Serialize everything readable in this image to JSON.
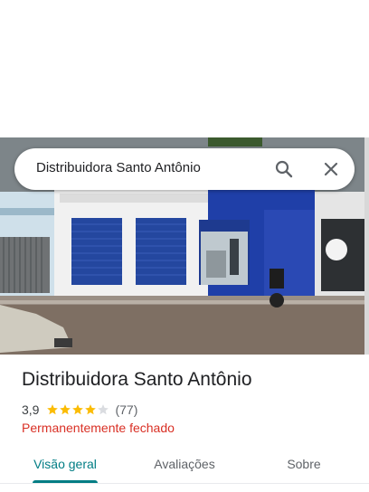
{
  "search": {
    "query": "Distribuidora Santo Antônio",
    "search_icon": "search-icon",
    "close_icon": "close-icon"
  },
  "hero": {
    "image": "storefront-photo"
  },
  "place": {
    "name": "Distribuidora Santo Antônio",
    "rating": "3,9",
    "stars": 3.9,
    "review_count": "(77)",
    "status": "Permanentemente fechado",
    "status_color": "#d93025",
    "star_color": "#fbbc04"
  },
  "tabs": [
    {
      "label": "Visão geral",
      "active": true
    },
    {
      "label": "Avaliações",
      "active": false
    },
    {
      "label": "Sobre",
      "active": false
    }
  ],
  "colors": {
    "accent": "#017d84",
    "text": "#202124"
  }
}
